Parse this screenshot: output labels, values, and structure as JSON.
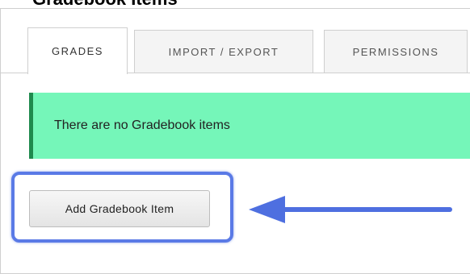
{
  "header": {
    "title": "Gradebook Items"
  },
  "tabs": [
    {
      "label": "GRADES",
      "active": true
    },
    {
      "label": "IMPORT / EXPORT",
      "active": false
    },
    {
      "label": "PERMISSIONS",
      "active": false
    }
  ],
  "alert": {
    "message": "There are no Gradebook items"
  },
  "actions": {
    "add_label": "Add Gradebook Item"
  },
  "colors": {
    "alert_bg": "#75f6b9",
    "alert_border": "#1f8a4e",
    "highlight": "#5a7ae6",
    "arrow": "#4e6fe0"
  }
}
